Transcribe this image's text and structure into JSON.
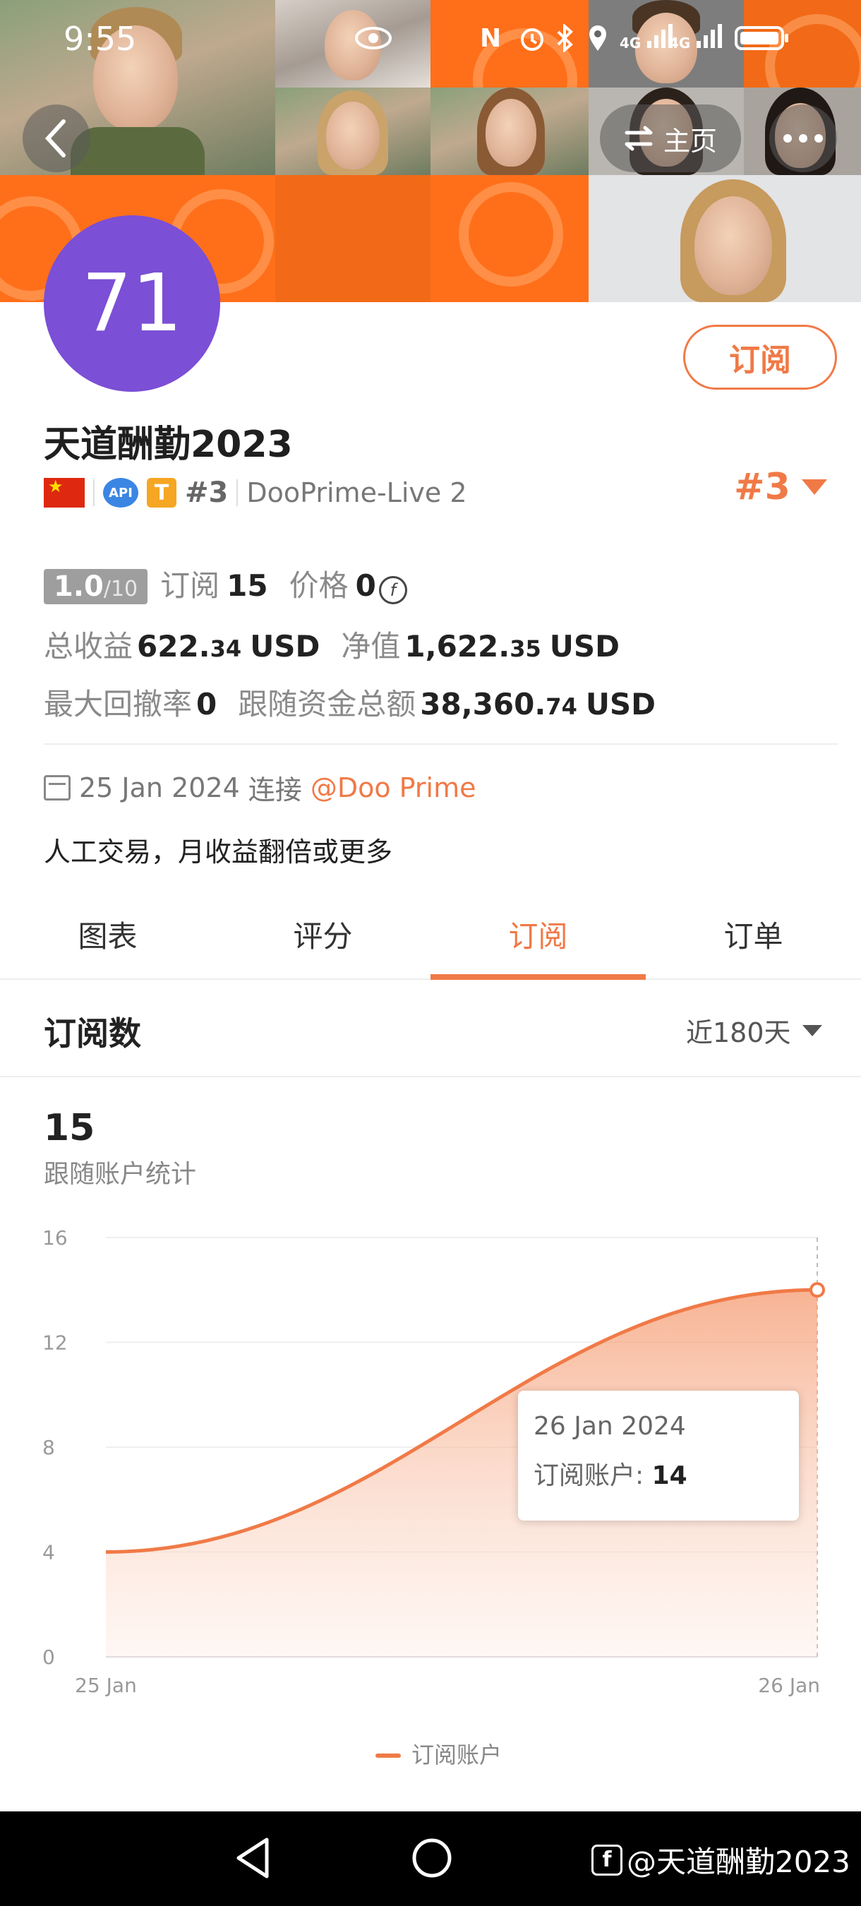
{
  "status_bar": {
    "time": "9:55",
    "net1": "4G",
    "net2": "4G"
  },
  "header": {
    "home_label": "主页"
  },
  "profile": {
    "avatar_text": "71",
    "subscribe_label": "订阅",
    "name": "天道酬勤2023",
    "rank_small": "#3",
    "server": "DooPrime-Live 2",
    "rank_big": "#3",
    "api_badge": "API",
    "t_badge": "T"
  },
  "stats": {
    "score": "1.0",
    "score_denominator": "/10",
    "subs_label": "订阅",
    "subs_value": "15",
    "price_label": "价格",
    "price_value": "0",
    "total_profit_label": "总收益",
    "total_profit_int": "622.",
    "total_profit_dec": "34",
    "total_profit_unit": "USD",
    "net_value_label": "净值",
    "net_value_int": "1,622.",
    "net_value_dec": "35",
    "net_value_unit": "USD",
    "max_dd_label": "最大回撤率",
    "max_dd_value": "0",
    "follow_funds_label": "跟随资金总额",
    "follow_funds_int": "38,360.",
    "follow_funds_dec": "74",
    "follow_funds_unit": "USD"
  },
  "since": {
    "date": "25 Jan 2024",
    "connect_label": "连接",
    "broker": "@Doo Prime"
  },
  "description": "人工交易，月收益翻倍或更多",
  "tabs": [
    {
      "label": "图表",
      "active": false
    },
    {
      "label": "评分",
      "active": false
    },
    {
      "label": "订阅",
      "active": true
    },
    {
      "label": "订单",
      "active": false
    }
  ],
  "section": {
    "title": "订阅数",
    "range": "近180天"
  },
  "summary": {
    "value": "15",
    "label": "跟随账户统计"
  },
  "chart_data": {
    "type": "area",
    "x": [
      "25 Jan",
      "26 Jan"
    ],
    "series": [
      {
        "name": "订阅账户",
        "values": [
          4,
          14
        ]
      }
    ],
    "ylim": [
      0,
      16
    ],
    "yticks": [
      0,
      4,
      8,
      12,
      16
    ],
    "grid": true,
    "legend": "bottom",
    "color": "#f07a47"
  },
  "tooltip": {
    "date": "26 Jan 2024",
    "label": "订阅账户: ",
    "value": "14"
  },
  "watermark": "@天道酬勤2023",
  "colors": {
    "accent": "#f07a47",
    "avatar": "#7b4fd6",
    "banner": "#ff7a1f"
  }
}
